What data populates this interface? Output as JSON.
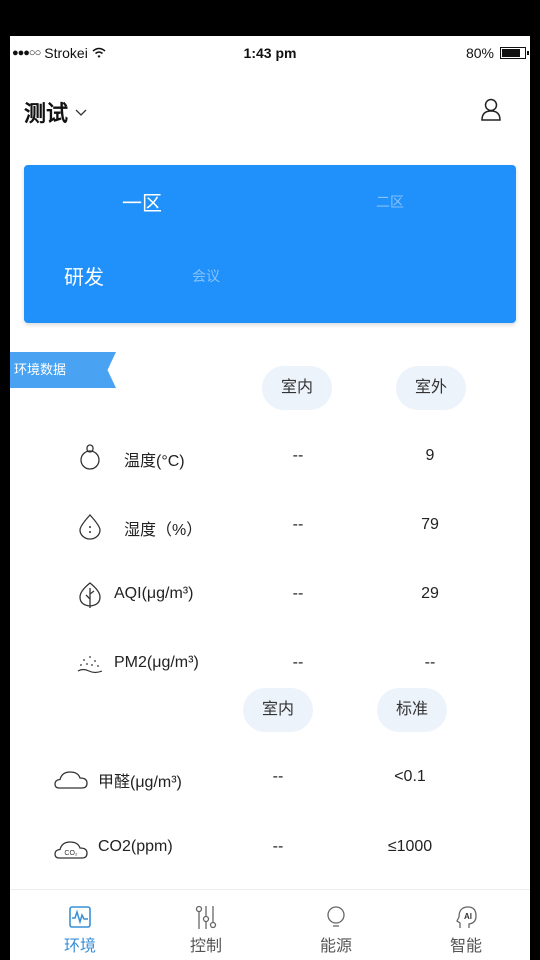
{
  "status_bar": {
    "signal": "●●●○○",
    "carrier": "Strokei",
    "time": "1:43 pm",
    "battery_percent": "80%",
    "battery_level": 0.8
  },
  "header": {
    "title": "测试",
    "dropdown_icon": "chevron-down-icon",
    "profile_icon": "user-icon"
  },
  "zone_card": {
    "zones": [
      {
        "label": "一区",
        "selected": true
      },
      {
        "label": "二区",
        "selected": false
      }
    ],
    "rooms": [
      {
        "label": "研发",
        "selected": true
      },
      {
        "label": "会议",
        "selected": false
      }
    ],
    "background_color": "#2090fa"
  },
  "environment": {
    "section_label": "环境数据",
    "outdoor_table": {
      "columns": [
        "室内",
        "室外"
      ],
      "rows": [
        {
          "icon": "thermometer-bulb-icon",
          "label": "温度(°C)",
          "indoor": "--",
          "outdoor": "9"
        },
        {
          "icon": "water-drop-icon",
          "label": "湿度（%）",
          "indoor": "--",
          "outdoor": "79"
        },
        {
          "icon": "leaf-icon",
          "label": "AQI(μg/m³)",
          "indoor": "--",
          "outdoor": "29"
        },
        {
          "icon": "dust-particles-icon",
          "label": "PM2(μg/m³)",
          "indoor": "--",
          "outdoor": "--"
        }
      ]
    },
    "standard_table": {
      "columns": [
        "室内",
        "标准"
      ],
      "rows": [
        {
          "icon": "cloud-icon",
          "label": "甲醛(μg/m³)",
          "indoor": "--",
          "standard": "<0.1"
        },
        {
          "icon": "co2-cloud-icon",
          "label": "CO2(ppm)",
          "indoor": "--",
          "standard": "≤1000"
        }
      ]
    }
  },
  "tab_bar": {
    "active_color": "#3a8fd6",
    "tabs": [
      {
        "label": "环境",
        "icon": "waveform-monitor-icon",
        "active": true
      },
      {
        "label": "控制",
        "icon": "sliders-icon",
        "active": false
      },
      {
        "label": "能源",
        "icon": "lightbulb-icon",
        "active": false
      },
      {
        "label": "智能",
        "icon": "ai-head-icon",
        "active": false
      }
    ]
  }
}
